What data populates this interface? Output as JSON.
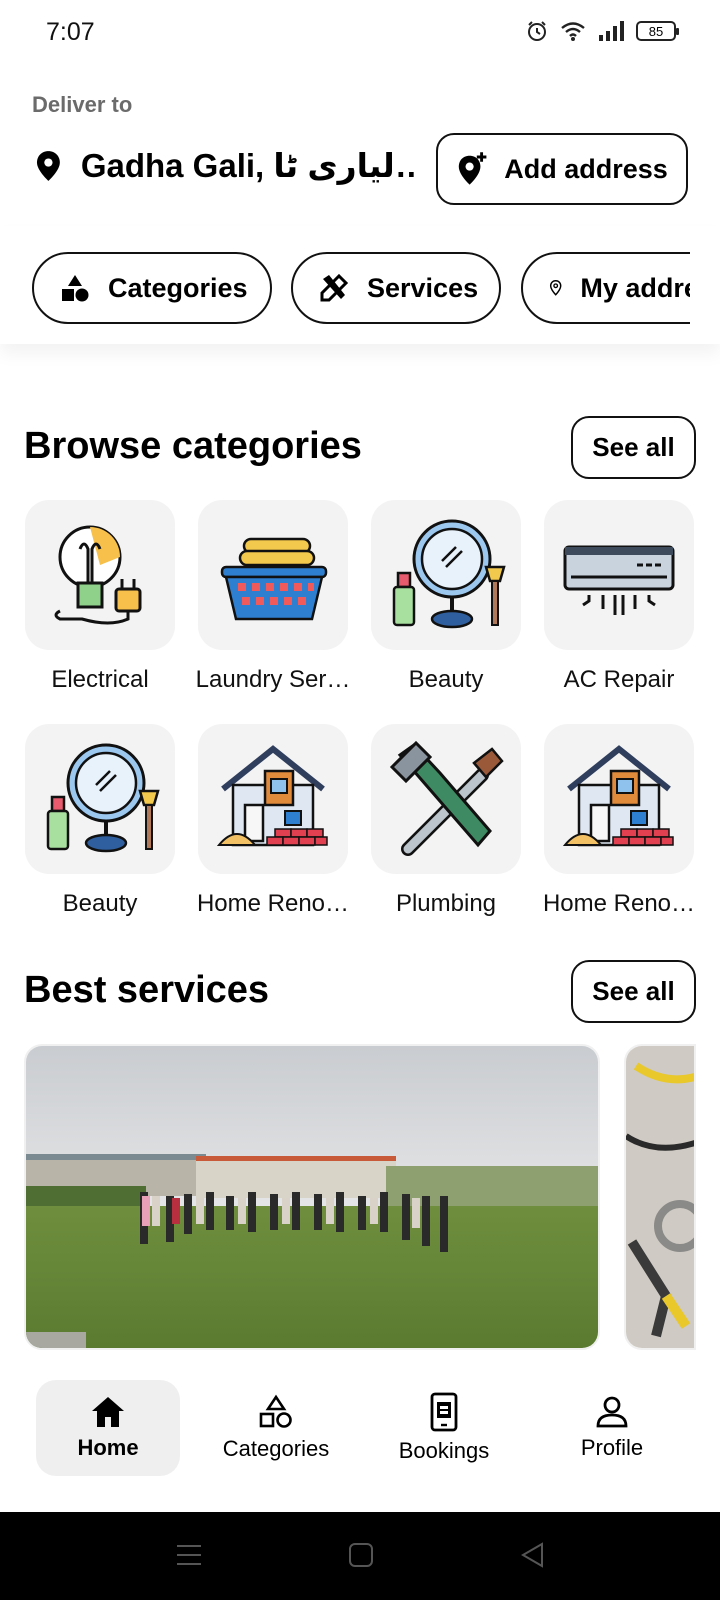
{
  "status": {
    "time": "7:07",
    "battery": "85"
  },
  "header": {
    "deliver_label": "Deliver to",
    "address": "Gadha Gali, لیاری ٹا…",
    "add_address_label": "Add address"
  },
  "chips": [
    {
      "label": "Categories",
      "icon": "shapes-icon"
    },
    {
      "label": "Services",
      "icon": "tools-icon"
    },
    {
      "label": "My addresses",
      "icon": "location-pin-icon"
    }
  ],
  "browse": {
    "title": "Browse categories",
    "see_all": "See all",
    "items": [
      {
        "label": "Electrical",
        "icon": "bulb-plug-icon"
      },
      {
        "label": "Laundry Ser…",
        "icon": "laundry-basket-icon"
      },
      {
        "label": "Beauty",
        "icon": "mirror-makeup-icon"
      },
      {
        "label": "AC Repair",
        "icon": "air-conditioner-icon"
      },
      {
        "label": "Beauty",
        "icon": "mirror-makeup-icon"
      },
      {
        "label": "Home Reno…",
        "icon": "house-renovation-icon"
      },
      {
        "label": "Plumbing",
        "icon": "wrench-icon"
      },
      {
        "label": "Home Reno…",
        "icon": "house-renovation-icon"
      }
    ]
  },
  "best": {
    "title": "Best services",
    "see_all": "See all"
  },
  "nav": [
    {
      "label": "Home",
      "icon": "home-icon",
      "active": true
    },
    {
      "label": "Categories",
      "icon": "shapes-outline-icon",
      "active": false
    },
    {
      "label": "Bookings",
      "icon": "booking-phone-icon",
      "active": false
    },
    {
      "label": "Profile",
      "icon": "person-icon",
      "active": false
    }
  ]
}
